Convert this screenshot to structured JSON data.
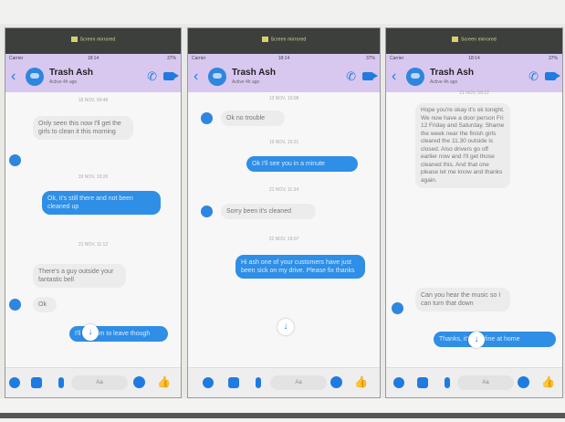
{
  "cast_label": "Screen mirrored",
  "phones": [
    {
      "status": {
        "carrier": "Carrier",
        "time": "18:14",
        "battery": "37%"
      },
      "contact": {
        "name": "Trash Ash",
        "active": "Active 4h ago"
      },
      "timestamps": [
        "18 NOV, 09:48",
        "19 NOV, 10:26",
        "21 NOV, 11:12"
      ],
      "incoming": [
        "Only seen this now I'll get the girls to clean it this morning",
        "There's a guy outside your fantastic bell",
        "Ok"
      ],
      "outgoing": [
        "Ok, it's still there and not been cleaned up",
        "I'll ask him to leave though"
      ],
      "composer": {
        "placeholder": "Aa"
      }
    },
    {
      "status": {
        "carrier": "Carrier",
        "time": "18:14",
        "battery": "37%"
      },
      "contact": {
        "name": "Trash Ash",
        "active": "Active 4h ago"
      },
      "timestamps": [
        "13 NOV, 10:08",
        "19 NOV, 10:31",
        "21 NOV, 11:34",
        "22 NOV, 19:07"
      ],
      "incoming": [
        "Ok no trouble",
        "Sorry been it's cleaned"
      ],
      "outgoing": [
        "Ok I'll see you in a minute",
        "Hi ash one of your customers have just been sick on my drive. Please fix thanks"
      ],
      "composer": {
        "placeholder": "Aa"
      }
    },
    {
      "status": {
        "carrier": "Carrier",
        "time": "18:14",
        "battery": "37%"
      },
      "contact": {
        "name": "Trash Ash",
        "active": "Active 4h ago"
      },
      "timestamps": [
        "21 NOV, 09:12"
      ],
      "incoming": [
        "Hope you're okay it's ok tonight. We now have a door person Fri 12 Friday and Saturday. Shame the week near the finish girls cleared the 11.30 outside is closed. Also drivers go off earlier now and I'll get those cleaned this. And that one please let me know and thanks again.",
        "Can you hear the music so I can turn that down"
      ],
      "outgoing": [
        "Thanks, it's just fine at home"
      ],
      "composer": {
        "placeholder": "Aa"
      }
    }
  ],
  "colors": {
    "accent": "#2f8ee6",
    "header": "#d8c8f0"
  },
  "icons": [
    "plus-icon",
    "camera-icon",
    "gallery-icon",
    "mic-icon",
    "emoji-icon",
    "like-icon"
  ]
}
